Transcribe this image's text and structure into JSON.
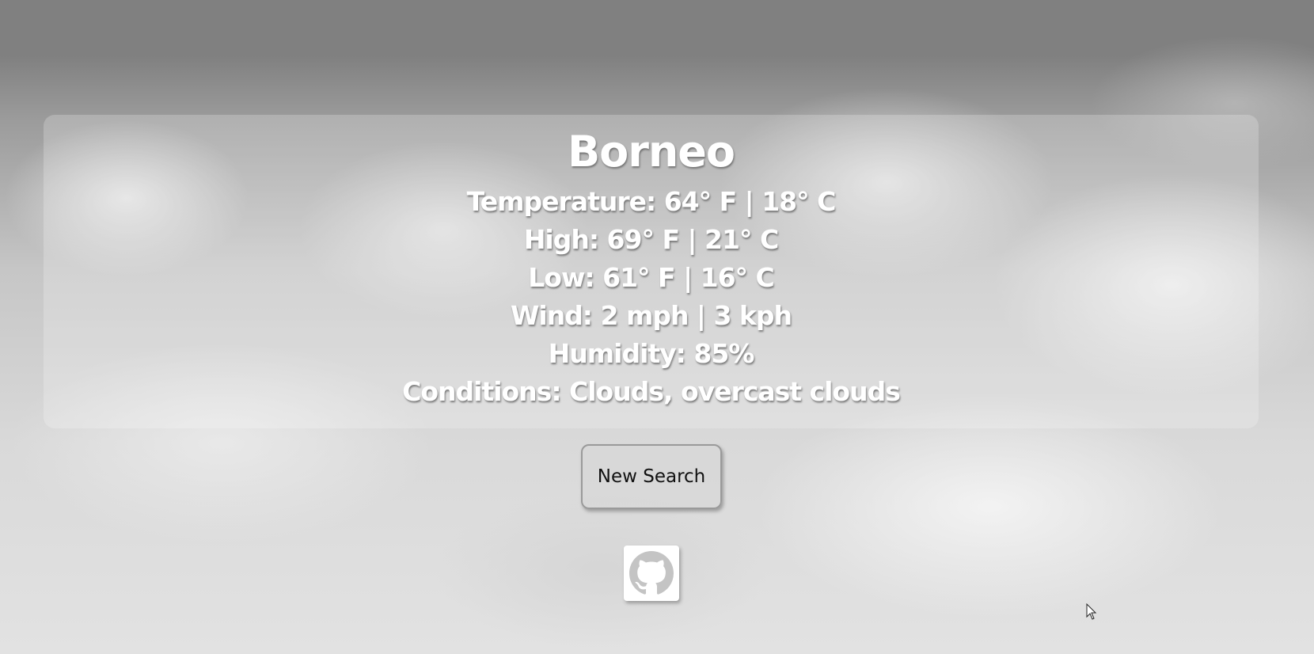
{
  "weather": {
    "city": "Borneo",
    "temperature": "Temperature: 64° F | 18° C",
    "high": "High: 69° F | 21° C",
    "low": "Low: 61° F | 16° C",
    "wind": "Wind: 2 mph | 3 kph",
    "humidity": "Humidity: 85%",
    "conditions": "Conditions: Clouds, overcast clouds"
  },
  "actions": {
    "new_search_label": "New Search"
  },
  "footer": {
    "github_icon": "github-icon"
  },
  "colors": {
    "sky_top": "#808080",
    "sky_bottom": "#e2e2e2",
    "text": "#ffffff"
  }
}
